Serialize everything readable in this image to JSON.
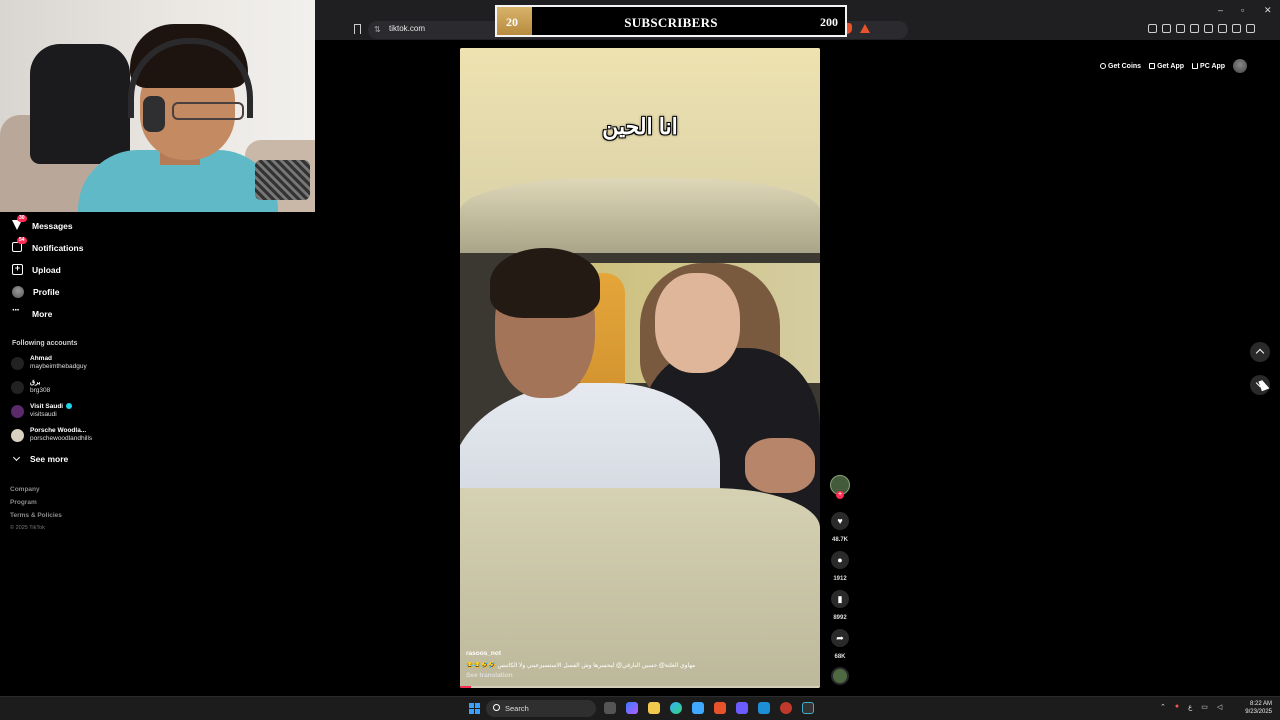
{
  "browser": {
    "url": "tiktok.com",
    "window_controls": [
      "–",
      "▫",
      "✕"
    ]
  },
  "overlay": {
    "current": "20",
    "title": "SUBSCRIBERS",
    "goal": "200",
    "progress_fraction": 0.1
  },
  "sidebar": {
    "nav": [
      {
        "label": "Messages",
        "badge": "30",
        "icon": "send-icon"
      },
      {
        "label": "Notifications",
        "badge": "54",
        "icon": "inbox-icon"
      },
      {
        "label": "Upload",
        "icon": "upload-plus-icon"
      },
      {
        "label": "Profile",
        "icon": "profile-avatar-icon"
      },
      {
        "label": "More",
        "icon": "more-dots-icon"
      }
    ],
    "following_title": "Following accounts",
    "accounts": [
      {
        "name": "Ahmad",
        "handle": "maybeimthebadguy"
      },
      {
        "name": "برق",
        "handle": "brg308"
      },
      {
        "name": "Visit Saudi",
        "handle": "visitsaudi",
        "verified": true
      },
      {
        "name": "Porsche Woodla...",
        "handle": "porschewoodlandhills"
      }
    ],
    "see_more": "See more",
    "footer": [
      "Company",
      "Program",
      "Terms & Policies"
    ],
    "copyright": "© 2025 TikTok"
  },
  "top_actions": {
    "coins": "Get Coins",
    "app": "Get App",
    "pc": "PC App"
  },
  "video": {
    "caption_overlay": "انا الحين",
    "author": "rasoos_not",
    "description": "مهاوي الغلثة@ حسين البارقي@ ليحسرها وش الفسل الاستسيزعيني ولا الكاتبس 🤣🤣😂😂",
    "see_translation": "See translation",
    "progress_fraction": 0.03
  },
  "actions": {
    "likes": "48.7K",
    "comments": "1912",
    "saves": "8992",
    "shares": "68K"
  },
  "taskbar": {
    "search_placeholder": "Search",
    "tray_lang": "ع",
    "time": "8:22 AM",
    "date": "9/23/2025"
  },
  "colors": {
    "accent": "#fe2c55",
    "overlay_fill": "#c99d50"
  }
}
